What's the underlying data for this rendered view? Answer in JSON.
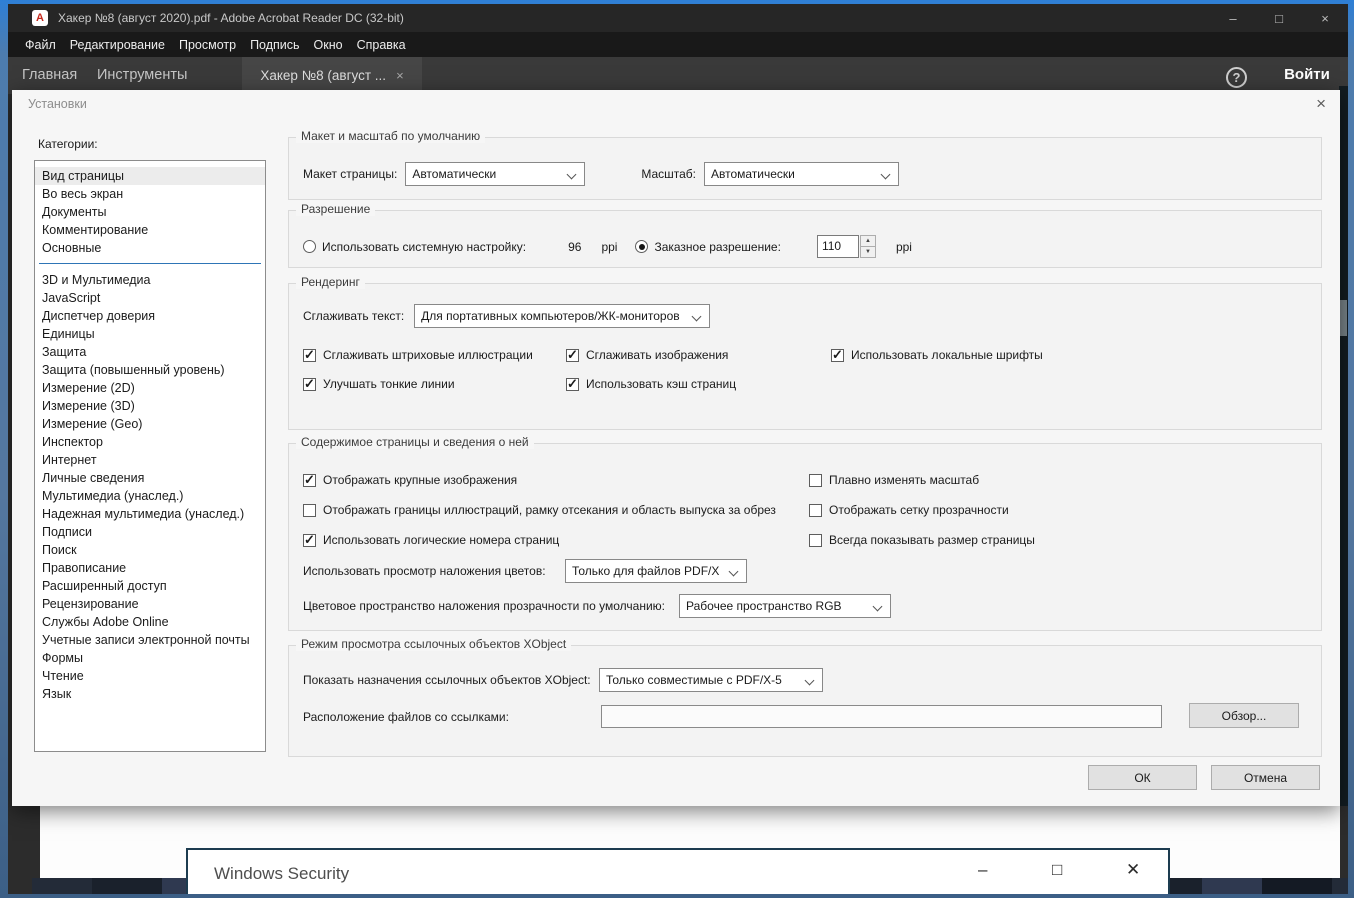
{
  "titlebar": {
    "app_icon_glyph": "A",
    "title": "Хакер №8 (август 2020).pdf - Adobe Acrobat Reader DC (32-bit)",
    "minimize": "–",
    "maximize": "□",
    "close": "×"
  },
  "menubar": {
    "items": [
      "Файл",
      "Редактирование",
      "Просмотр",
      "Подпись",
      "Окно",
      "Справка"
    ]
  },
  "tabbar": {
    "home": "Главная",
    "tools": "Инструменты",
    "doc_tab": "Хакер №8 (август ...",
    "doc_tab_close": "×",
    "help": "?",
    "sign_in": "Войти"
  },
  "dialog": {
    "title": "Установки",
    "close": "×",
    "categories_label": "Категории:",
    "selected_category": "Вид страницы",
    "categories_top": [
      "Вид страницы",
      "Во весь экран",
      "Документы",
      "Комментирование",
      "Основные"
    ],
    "categories_bottom": [
      "3D и Мультимедиа",
      "JavaScript",
      "Диспетчер доверия",
      "Единицы",
      "Защита",
      "Защита (повышенный уровень)",
      "Измерение (2D)",
      "Измерение (3D)",
      "Измерение (Geo)",
      "Инспектор",
      "Интернет",
      "Личные сведения",
      "Мультимедиа (унаслед.)",
      "Надежная мультимедиа (унаслед.)",
      "Подписи",
      "Поиск",
      "Правописание",
      "Расширенный доступ",
      "Рецензирование",
      "Службы Adobe Online",
      "Учетные записи электронной почты",
      "Формы",
      "Чтение",
      "Язык"
    ],
    "layout_section": {
      "title": "Макет и масштаб по умолчанию",
      "page_layout_label": "Макет страницы:",
      "page_layout_value": "Автоматически",
      "zoom_label": "Масштаб:",
      "zoom_value": "Автоматически"
    },
    "resolution_section": {
      "title": "Разрешение",
      "system_label": "Использовать системную настройку:",
      "system_checked": false,
      "system_value": "96",
      "system_unit": "ppi",
      "custom_label": "Заказное разрешение:",
      "custom_checked": true,
      "custom_value": "110",
      "custom_unit": "ppi"
    },
    "rendering_section": {
      "title": "Рендеринг",
      "smooth_text_label": "Сглаживать текст:",
      "smooth_text_value": "Для портативных компьютеров/ЖК-мониторов",
      "checkboxes": [
        {
          "label": "Сглаживать штриховые иллюстрации",
          "checked": true
        },
        {
          "label": "Сглаживать изображения",
          "checked": true
        },
        {
          "label": "Использовать локальные шрифты",
          "checked": true
        },
        {
          "label": "Улучшать тонкие линии",
          "checked": true
        },
        {
          "label": "Использовать кэш страниц",
          "checked": true
        }
      ]
    },
    "content_section": {
      "title": "Содержимое страницы и сведения о ней",
      "checkboxes_left": [
        {
          "label": "Отображать крупные изображения",
          "checked": true
        },
        {
          "label": "Отображать границы иллюстраций, рамку отсекания и область выпуска за обрез",
          "checked": false
        },
        {
          "label": "Использовать логические номера страниц",
          "checked": true
        }
      ],
      "checkboxes_right": [
        {
          "label": "Плавно изменять масштаб",
          "checked": false
        },
        {
          "label": "Отображать сетку прозрачности",
          "checked": false
        },
        {
          "label": "Всегда показывать размер страницы",
          "checked": false
        }
      ],
      "overprint_label": "Использовать просмотр наложения цветов:",
      "overprint_value": "Только для файлов PDF/X",
      "blend_label": "Цветовое пространство наложения прозрачности по умолчанию:",
      "blend_value": "Рабочее пространство RGB"
    },
    "xobject_section": {
      "title": "Режим просмотра ссылочных объектов XObject",
      "show_label": "Показать назначения ссылочных объектов XObject:",
      "show_value": "Только совместимые с PDF/X-5",
      "location_label": "Расположение файлов со ссылками:",
      "location_value": "",
      "browse_label": "Обзор...",
      "spin_up": "▲",
      "spin_down": "▼"
    },
    "ok_label": "ОК",
    "cancel_label": "Отмена"
  },
  "security_window": {
    "title": "Windows Security",
    "minimize": "–",
    "maximize": "□",
    "close": "✕"
  },
  "colors": {
    "accent_blue": "#2e75b6",
    "titlebar_bg": "#262626",
    "tabbar_bg": "#3a3a3a",
    "dialog_bg": "#f6f6f6"
  }
}
